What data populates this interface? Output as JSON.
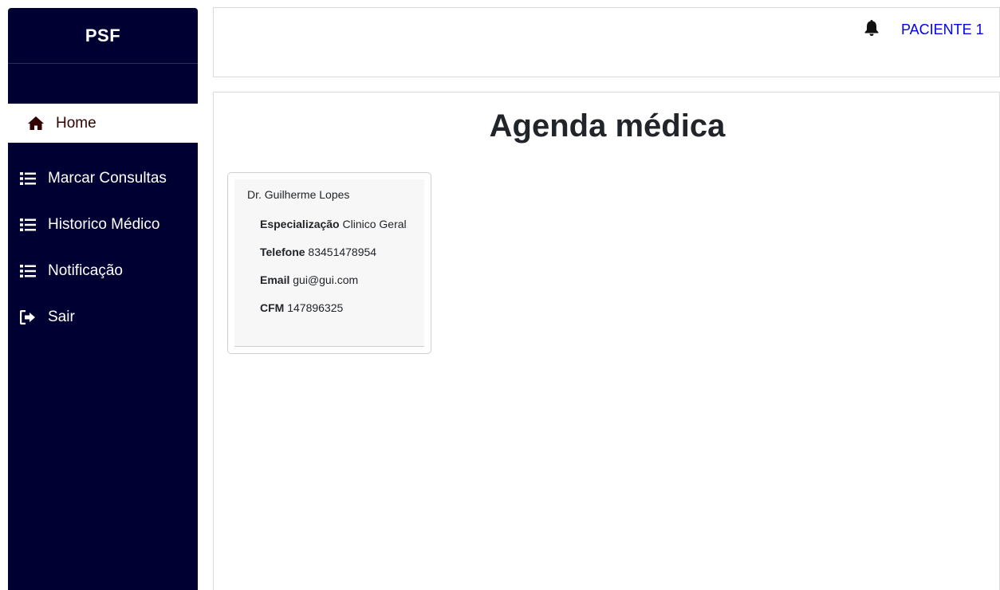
{
  "sidebar": {
    "brand": "PSF",
    "items": [
      {
        "label": "Home",
        "icon": "home-icon",
        "active": true
      },
      {
        "label": "Marcar Consultas",
        "icon": "list-icon"
      },
      {
        "label": "Historico Médico",
        "icon": "list-icon"
      },
      {
        "label": "Notificação",
        "icon": "list-icon"
      },
      {
        "label": "Sair",
        "icon": "sign-out-icon"
      }
    ],
    "colors": {
      "background": "#000033",
      "active_text": "#330000"
    }
  },
  "header": {
    "notification_icon": "bell-icon",
    "user_label": "PACIENTE 1",
    "link_color": "#0000ee"
  },
  "main": {
    "title": "Agenda médica",
    "card": {
      "doctor": "Dr. Guilherme Lopes",
      "fields": [
        {
          "label": "Especialização",
          "value": "Clinico Geral"
        },
        {
          "label": "Telefone",
          "value": "83451478954"
        },
        {
          "label": "Email",
          "value": "gui@gui.com"
        },
        {
          "label": "CFM",
          "value": "147896325"
        }
      ]
    }
  }
}
